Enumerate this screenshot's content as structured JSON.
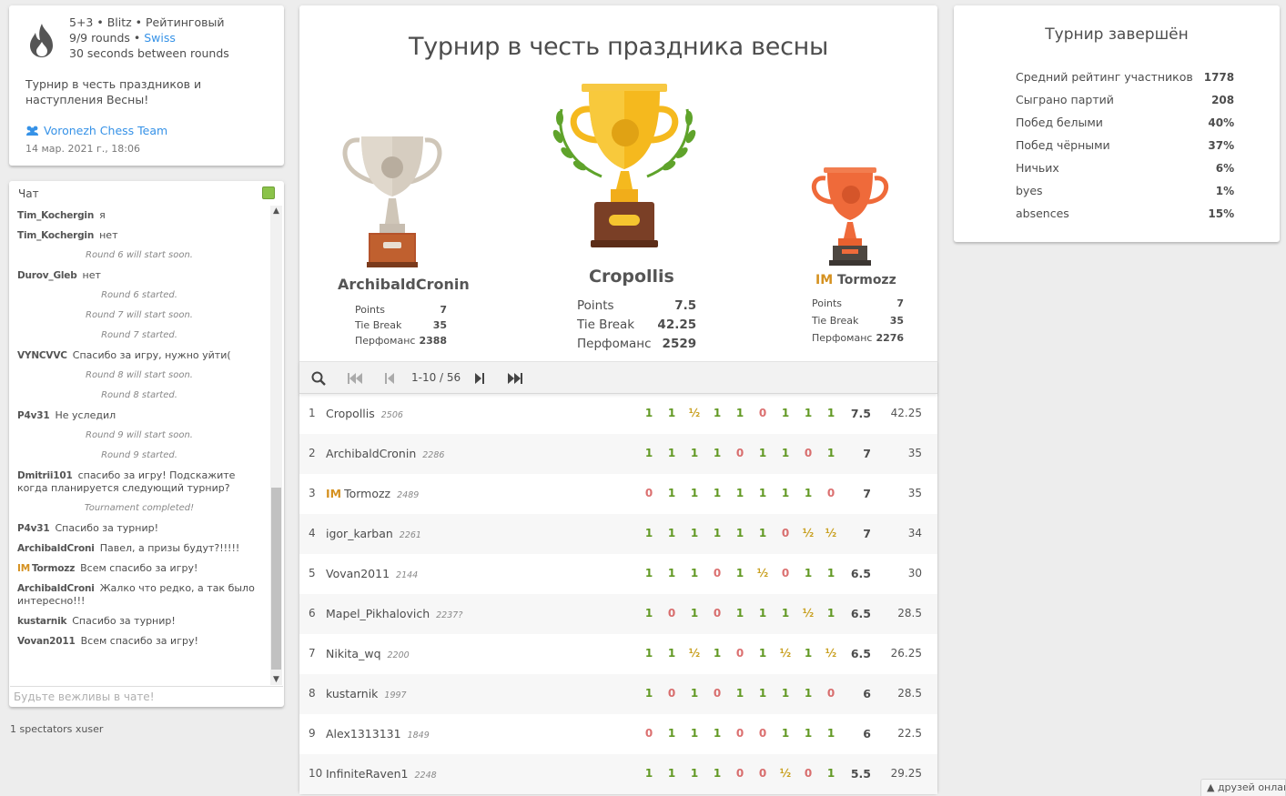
{
  "info": {
    "line1": "5+3 • Blitz • Рейтинговый",
    "rounds": "9/9 rounds • ",
    "system": "Swiss",
    "line3": "30 seconds between rounds",
    "description": "Турнир в честь праздников и наступления Весны!",
    "team": "Voronezh Chess Team",
    "date": "14 мар. 2021 г., 18:06"
  },
  "chat": {
    "title": "Чат",
    "placeholder": "Будьте вежливы в чате!",
    "messages": [
      {
        "user": "Tim_Kochergin",
        "text": "я"
      },
      {
        "user": "Tim_Kochergin",
        "text": "нет"
      },
      {
        "system": "Round 6 will start soon."
      },
      {
        "user": "Durov_Gleb",
        "text": "нет"
      },
      {
        "system": "Round 6 started."
      },
      {
        "system": "Round 7 will start soon."
      },
      {
        "system": "Round 7 started."
      },
      {
        "user": "VYNCVVC",
        "text": "Спасибо за игру, нужно уйти("
      },
      {
        "system": "Round 8 will start soon."
      },
      {
        "system": "Round 8 started."
      },
      {
        "user": "P4v31",
        "text": "Не уследил"
      },
      {
        "system": "Round 9 will start soon."
      },
      {
        "system": "Round 9 started."
      },
      {
        "user": "Dmitrii101",
        "text": "спасибо за игру! Подскажите когда планируется следующий турнир?"
      },
      {
        "system": "Tournament completed!"
      },
      {
        "user": "P4v31",
        "text": "Спасибо за турнир!"
      },
      {
        "user": "ArchibaldCroni",
        "text": "Павел, а призы будут?!!!!!"
      },
      {
        "user": "Tormozz",
        "title": "IM",
        "text": "Всем спасибо за игру!"
      },
      {
        "user": "ArchibaldCroni",
        "text": "Жалко что редко, а так было интересно!!!"
      },
      {
        "user": "kustarnik",
        "text": "Спасибо за турнир!"
      },
      {
        "user": "Vovan2011",
        "text": "Всем спасибо за игру!"
      }
    ]
  },
  "spectators": "1 spectators xuser",
  "tournament": {
    "title": "Турнир в честь праздника весны",
    "podium": {
      "first": {
        "name": "Cropollis",
        "title": "",
        "points": "7.5",
        "tiebreak": "42.25",
        "perf": "2529"
      },
      "second": {
        "name": "ArchibaldCronin",
        "title": "",
        "points": "7",
        "tiebreak": "35",
        "perf": "2388"
      },
      "third": {
        "name": "Tormozz",
        "title": "IM",
        "points": "7",
        "tiebreak": "35",
        "perf": "2276"
      }
    },
    "labels": {
      "points": "Points",
      "tiebreak": "Tie Break",
      "perf": "Перфоманс"
    }
  },
  "pager": {
    "range": "1-10 / 56"
  },
  "standings": [
    {
      "rank": "1",
      "title": "",
      "name": "Cropollis",
      "rating": "2506",
      "sheet": [
        "1",
        "1",
        "½",
        "1",
        "1",
        "0",
        "1",
        "1",
        "1"
      ],
      "total": "7.5",
      "tb": "42.25"
    },
    {
      "rank": "2",
      "title": "",
      "name": "ArchibaldCronin",
      "rating": "2286",
      "sheet": [
        "1",
        "1",
        "1",
        "1",
        "0",
        "1",
        "1",
        "0",
        "1"
      ],
      "total": "7",
      "tb": "35"
    },
    {
      "rank": "3",
      "title": "IM",
      "name": "Tormozz",
      "rating": "2489",
      "sheet": [
        "0",
        "1",
        "1",
        "1",
        "1",
        "1",
        "1",
        "1",
        "0"
      ],
      "total": "7",
      "tb": "35"
    },
    {
      "rank": "4",
      "title": "",
      "name": "igor_karban",
      "rating": "2261",
      "sheet": [
        "1",
        "1",
        "1",
        "1",
        "1",
        "1",
        "0",
        "½",
        "½"
      ],
      "total": "7",
      "tb": "34"
    },
    {
      "rank": "5",
      "title": "",
      "name": "Vovan2011",
      "rating": "2144",
      "sheet": [
        "1",
        "1",
        "1",
        "0",
        "1",
        "½",
        "0",
        "1",
        "1"
      ],
      "total": "6.5",
      "tb": "30"
    },
    {
      "rank": "6",
      "title": "",
      "name": "Mapel_Pikhalovich",
      "rating": "2237?",
      "sheet": [
        "1",
        "0",
        "1",
        "0",
        "1",
        "1",
        "1",
        "½",
        "1"
      ],
      "total": "6.5",
      "tb": "28.5"
    },
    {
      "rank": "7",
      "title": "",
      "name": "Nikita_wq",
      "rating": "2200",
      "sheet": [
        "1",
        "1",
        "½",
        "1",
        "0",
        "1",
        "½",
        "1",
        "½"
      ],
      "total": "6.5",
      "tb": "26.25"
    },
    {
      "rank": "8",
      "title": "",
      "name": "kustarnik",
      "rating": "1997",
      "sheet": [
        "1",
        "0",
        "1",
        "0",
        "1",
        "1",
        "1",
        "1",
        "0"
      ],
      "total": "6",
      "tb": "28.5"
    },
    {
      "rank": "9",
      "title": "",
      "name": "Alex1313131",
      "rating": "1849",
      "sheet": [
        "0",
        "1",
        "1",
        "1",
        "0",
        "0",
        "1",
        "1",
        "1"
      ],
      "total": "6",
      "tb": "22.5"
    },
    {
      "rank": "10",
      "title": "",
      "name": "InfiniteRaven1",
      "rating": "2248",
      "sheet": [
        "1",
        "1",
        "1",
        "1",
        "0",
        "0",
        "½",
        "0",
        "1"
      ],
      "total": "5.5",
      "tb": "29.25"
    }
  ],
  "stats": {
    "title": "Турнир завершён",
    "rows": [
      {
        "label": "Средний рейтинг участников",
        "value": "1778"
      },
      {
        "label": "Сыграно партий",
        "value": "208"
      },
      {
        "label": "Побед белыми",
        "value": "40%"
      },
      {
        "label": "Побед чёрными",
        "value": "37%"
      },
      {
        "label": "Ничьих",
        "value": "6%"
      },
      {
        "label": "byes",
        "value": "1%"
      },
      {
        "label": "absences",
        "value": "15%"
      }
    ]
  },
  "friends": "▲ друзей онлайн"
}
